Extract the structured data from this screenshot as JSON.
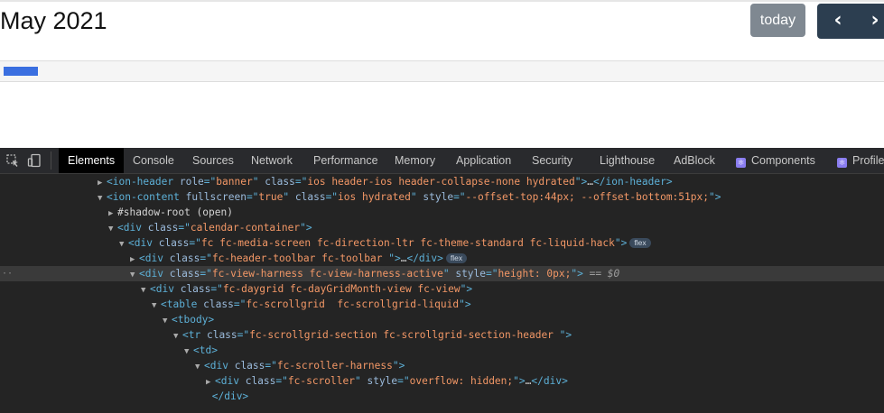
{
  "calendar": {
    "title": "May 2021",
    "today_label": "today",
    "prev_label": "‹",
    "next_label": "›"
  },
  "devtools": {
    "tabs": [
      {
        "label": "Elements",
        "active": true
      },
      {
        "label": "Console"
      },
      {
        "label": "Sources"
      },
      {
        "label": "Network"
      },
      {
        "label": "Performance"
      },
      {
        "label": "Memory"
      },
      {
        "label": "Application"
      },
      {
        "label": "Security"
      },
      {
        "label": "Lighthouse"
      },
      {
        "label": "AdBlock"
      },
      {
        "label": "Components",
        "icon": "react-icon"
      },
      {
        "label": "Profiler",
        "icon": "react-icon"
      }
    ],
    "flex_badge": "flex",
    "selected_marker": "== $0",
    "elements": [
      {
        "tag": "ion-header",
        "attrs": [
          [
            "role",
            "banner"
          ],
          [
            "class",
            "ios header-ios header-collapse-none hydrated"
          ]
        ],
        "collapsed": true,
        "close": "</ion-header>"
      },
      {
        "tag": "ion-content",
        "attrs": [
          [
            "fullscreen",
            "true"
          ],
          [
            "class",
            "ios hydrated"
          ],
          [
            "style",
            "--offset-top:44px; --offset-bottom:51px;"
          ]
        ]
      },
      {
        "text": "#shadow-root (open)"
      },
      {
        "tag": "div",
        "attrs": [
          [
            "class",
            "calendar-container"
          ]
        ]
      },
      {
        "tag": "div",
        "attrs": [
          [
            "class",
            "fc fc-media-screen fc-direction-ltr fc-theme-standard fc-liquid-hack"
          ]
        ]
      },
      {
        "tag": "div",
        "attrs": [
          [
            "class",
            "fc-header-toolbar fc-toolbar "
          ]
        ],
        "collapsed": true,
        "close": "</div>"
      },
      {
        "tag": "div",
        "attrs": [
          [
            "class",
            "fc-view-harness fc-view-harness-active"
          ],
          [
            "style",
            "height: 0px;"
          ]
        ]
      },
      {
        "tag": "div",
        "attrs": [
          [
            "class",
            "fc-daygrid fc-dayGridMonth-view fc-view"
          ]
        ]
      },
      {
        "tag": "table",
        "attrs": [
          [
            "class",
            "fc-scrollgrid  fc-scrollgrid-liquid"
          ]
        ]
      },
      {
        "tag": "tbody",
        "attrs": []
      },
      {
        "tag": "tr",
        "attrs": [
          [
            "class",
            "fc-scrollgrid-section fc-scrollgrid-section-header "
          ]
        ]
      },
      {
        "tag": "td",
        "attrs": []
      },
      {
        "tag": "div",
        "attrs": [
          [
            "class",
            "fc-scroller-harness"
          ]
        ]
      },
      {
        "tag": "div",
        "attrs": [
          [
            "class",
            "fc-scroller"
          ],
          [
            "style",
            "overflow: hidden;"
          ]
        ],
        "collapsed": true,
        "close": "</div>"
      },
      {
        "text": "</div>"
      }
    ]
  }
}
